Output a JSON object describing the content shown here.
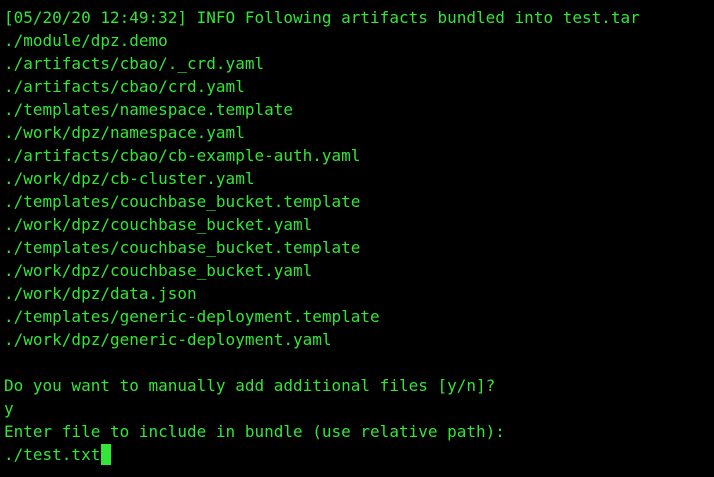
{
  "terminal": {
    "colors": {
      "background": "#000000",
      "foreground": "#32e636",
      "cursor": "#32e636"
    },
    "log_header": "[05/20/20 12:49:32] INFO Following artifacts bundled into test.tar",
    "files": [
      "./module/dpz.demo",
      "./artifacts/cbao/._crd.yaml",
      "./artifacts/cbao/crd.yaml",
      "./templates/namespace.template",
      "./work/dpz/namespace.yaml",
      "./artifacts/cbao/cb-example-auth.yaml",
      "./work/dpz/cb-cluster.yaml",
      "./templates/couchbase_bucket.template",
      "./work/dpz/couchbase_bucket.yaml",
      "./templates/couchbase_bucket.template",
      "./work/dpz/couchbase_bucket.yaml",
      "./work/dpz/data.json",
      "./templates/generic-deployment.template",
      "./work/dpz/generic-deployment.yaml"
    ],
    "prompt_add_files": "Do you want to manually add additional files [y/n]?",
    "answer_add_files": "y",
    "prompt_file": "Enter file to include in bundle (use relative path):",
    "current_input": "./test.txt"
  }
}
